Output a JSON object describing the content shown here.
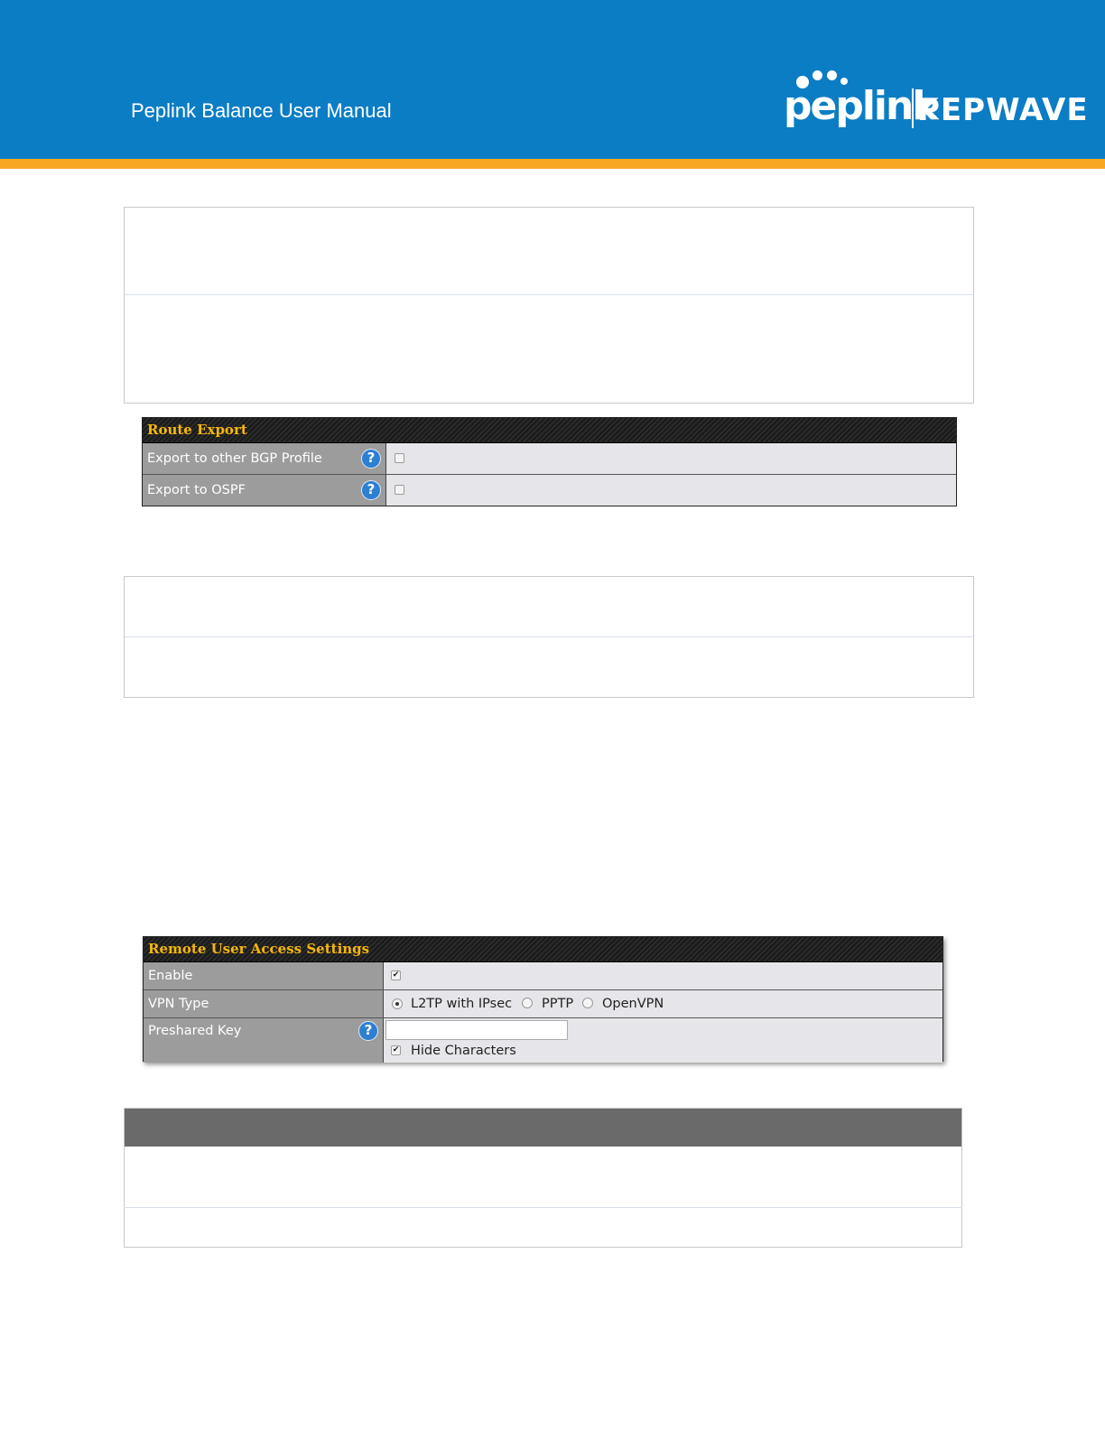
{
  "header": {
    "title": "Peplink Balance User Manual",
    "logo_left": "peplink",
    "logo_right": "PEPWAVE",
    "colors": {
      "band": "#0b7dc4",
      "stripe": "#f7a823"
    }
  },
  "route_export": {
    "title": "Route Export",
    "rows": [
      {
        "label": "Export to other BGP Profile",
        "help": "?",
        "checked": false
      },
      {
        "label": "Export to OSPF",
        "help": "?",
        "checked": false
      }
    ]
  },
  "remote_access": {
    "title": "Remote User Access Settings",
    "enable": {
      "label": "Enable",
      "checked": true,
      "mark": "✔"
    },
    "vpn_type": {
      "label": "VPN Type",
      "options": [
        "L2TP with IPsec",
        "PPTP",
        "OpenVPN"
      ],
      "selected": "L2TP with IPsec"
    },
    "preshared_key": {
      "label": "Preshared Key",
      "help": "?",
      "value": "",
      "hide_label": "Hide Characters",
      "hide_checked": true,
      "mark": "✔"
    }
  }
}
